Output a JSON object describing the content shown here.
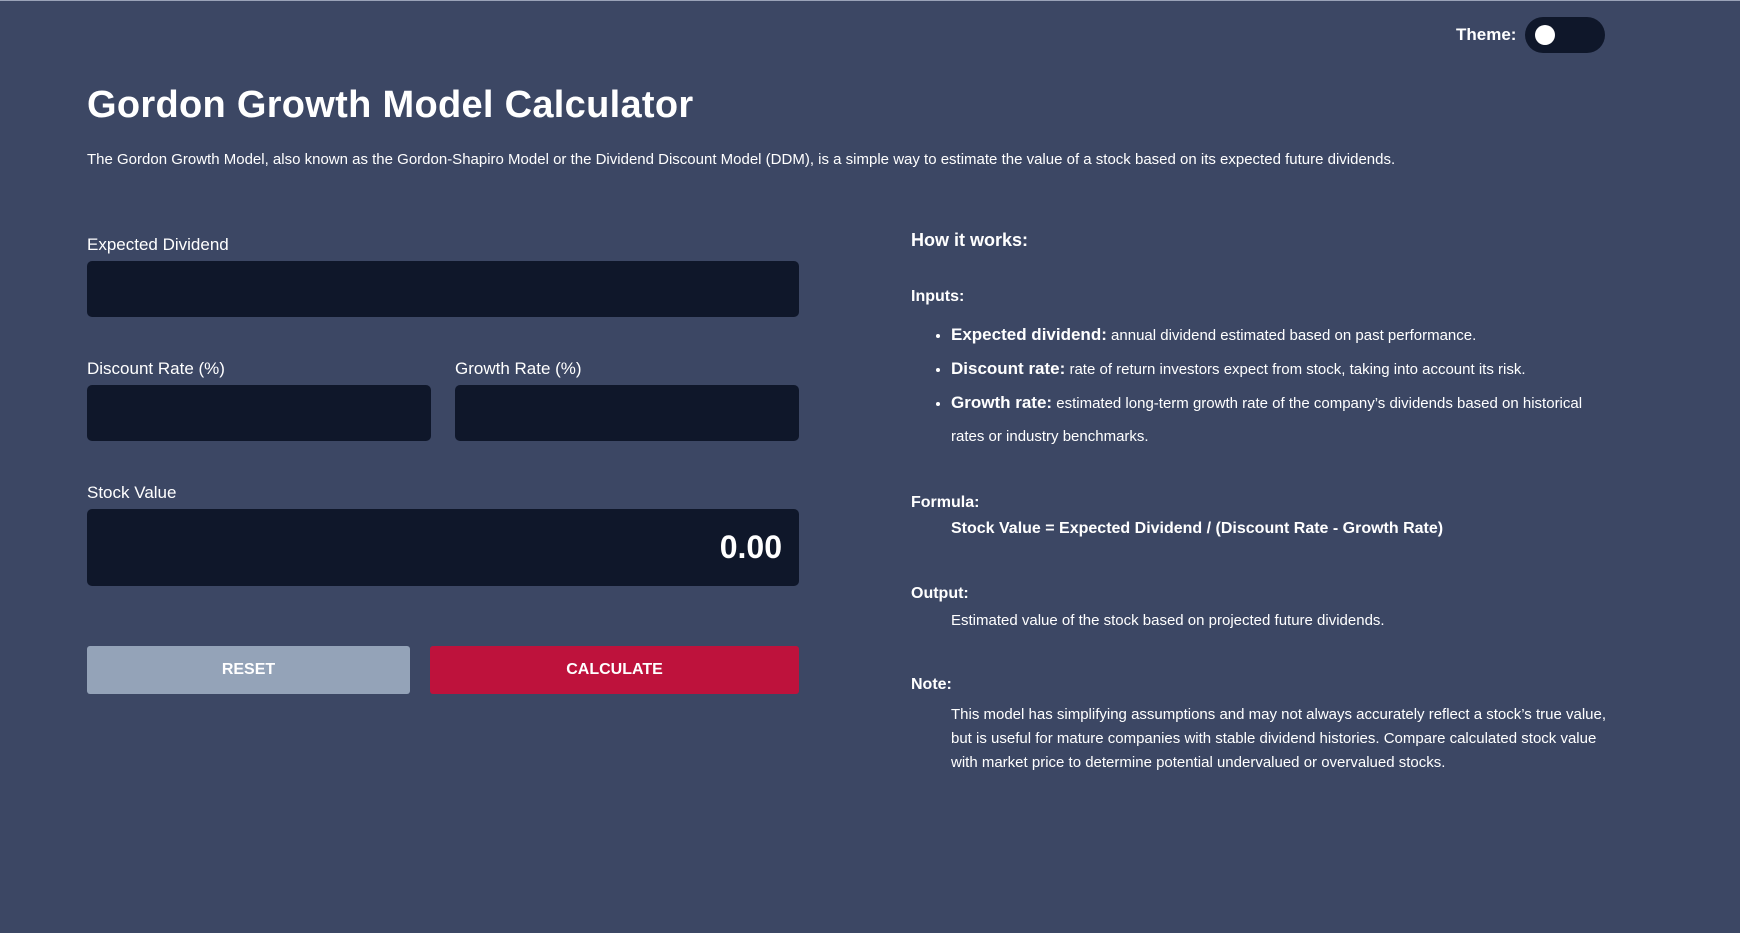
{
  "theme": {
    "label": "Theme:"
  },
  "header": {
    "title": "Gordon Growth Model Calculator",
    "description": "The Gordon Growth Model, also known as the Gordon-Shapiro Model or the Dividend Discount Model (DDM), is a simple way to estimate the value of a stock based on its expected future dividends."
  },
  "form": {
    "expected_dividend": {
      "label": "Expected Dividend",
      "value": ""
    },
    "discount_rate": {
      "label": "Discount Rate (%)",
      "value": ""
    },
    "growth_rate": {
      "label": "Growth Rate (%)",
      "value": ""
    },
    "stock_value": {
      "label": "Stock Value",
      "value": "0.00"
    },
    "reset_label": "RESET",
    "calculate_label": "CALCULATE"
  },
  "info": {
    "heading": "How it works:",
    "inputs_heading": "Inputs:",
    "inputs": [
      {
        "term": "Expected dividend:",
        "text": "annual dividend estimated based on past performance."
      },
      {
        "term": "Discount rate:",
        "text": "rate of return investors expect from stock, taking into account its risk."
      },
      {
        "term": "Growth rate:",
        "text": "estimated long-term growth rate of the company’s dividends based on historical rates or industry benchmarks."
      }
    ],
    "formula_heading": "Formula:",
    "formula": "Stock Value = Expected Dividend / (Discount Rate - Growth Rate)",
    "output_heading": "Output:",
    "output": "Estimated value of the stock based on projected future dividends.",
    "note_heading": "Note:",
    "note": "This model has simplifying assumptions and may not always accurately reflect a stock’s true value, but is useful for mature companies with stable dividend histories. Compare calculated stock value with market price to determine potential undervalued or overvalued stocks."
  },
  "colors": {
    "background": "#3c4764",
    "input_background": "#0f172a",
    "reset_button": "#94a3b8",
    "calculate_button": "#be123c"
  }
}
